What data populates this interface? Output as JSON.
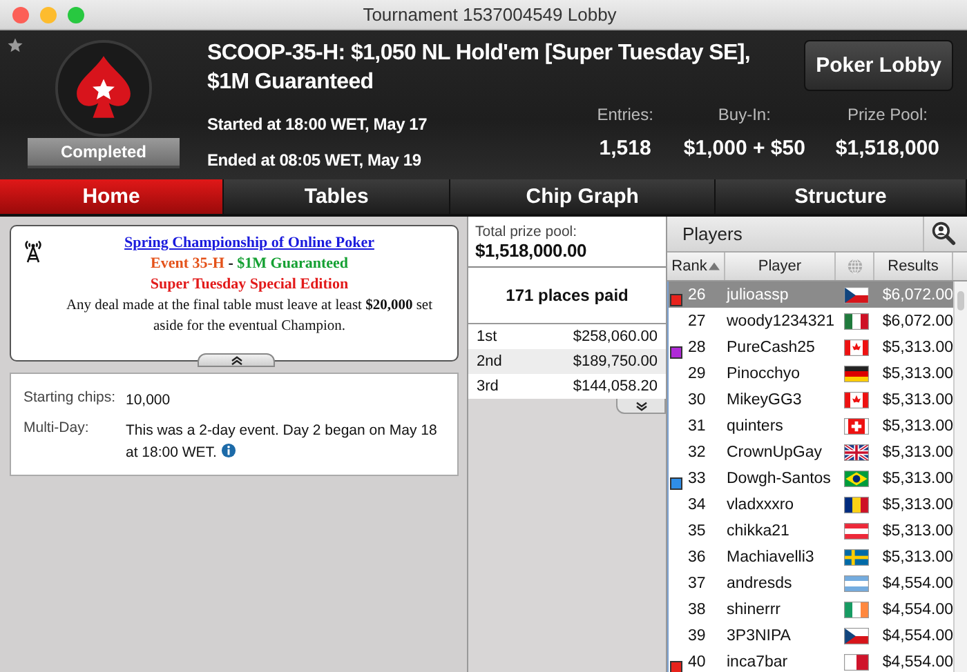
{
  "window": {
    "title": "Tournament 1537004549 Lobby"
  },
  "header": {
    "status": "Completed",
    "title": "SCOOP-35-H: $1,050 NL Hold'em [Super Tuesday SE], $1M Guaranteed",
    "started": "Started at 18:00 WET, May 17",
    "ended": "Ended at 08:05 WET, May 19",
    "stats": [
      {
        "label": "Entries:",
        "value": "1,518"
      },
      {
        "label": "Buy-In:",
        "value": "$1,000 + $50"
      },
      {
        "label": "Prize Pool:",
        "value": "$1,518,000"
      }
    ],
    "button": "Poker Lobby"
  },
  "tabs": [
    {
      "label": "Home",
      "selected": true
    },
    {
      "label": "Tables",
      "selected": false
    },
    {
      "label": "Chip Graph",
      "selected": false
    },
    {
      "label": "Structure",
      "selected": false
    }
  ],
  "announcement": {
    "link": "Spring Championship of Online Poker",
    "event": "Event 35-H",
    "separator": "-",
    "guarantee": "$1M Guaranteed",
    "edition": "Super Tuesday Special Edition",
    "notice": "Any deal made at the final table must leave at least **$20,000** set aside for the eventual Champion."
  },
  "details": [
    {
      "label": "Starting chips:",
      "value": "10,000",
      "info": false
    },
    {
      "label": "Multi-Day:",
      "value": "This was a 2-day event. Day 2 began on May 18 at 18:00 WET.",
      "info": true
    }
  ],
  "prizes": {
    "total_label": "Total prize pool:",
    "total": "$1,518,000.00",
    "places": "171 places paid",
    "rows": [
      {
        "place": "1st",
        "amount": "$258,060.00"
      },
      {
        "place": "2nd",
        "amount": "$189,750.00"
      },
      {
        "place": "3rd",
        "amount": "$144,058.20"
      }
    ]
  },
  "players": {
    "title": "Players",
    "columns": [
      "Rank",
      "Player",
      "Results"
    ],
    "rows": [
      {
        "rank": "26",
        "name": "julioassp",
        "kind": "czech",
        "result": "$6,072.00",
        "selected": true,
        "color": "#e8231c"
      },
      {
        "rank": "27",
        "name": "woody1234321",
        "kind": "mexico",
        "result": "$6,072.00",
        "selected": false
      },
      {
        "rank": "28",
        "name": "PureCash25",
        "kind": "canada",
        "result": "$5,313.00",
        "selected": false,
        "color": "#b02ad8"
      },
      {
        "rank": "29",
        "name": "Pinocchyo",
        "kind": "germany",
        "result": "$5,313.00",
        "selected": false
      },
      {
        "rank": "30",
        "name": "MikeyGG3",
        "kind": "canada",
        "result": "$5,313.00",
        "selected": false
      },
      {
        "rank": "31",
        "name": "quinters",
        "kind": "swiss",
        "result": "$5,313.00",
        "selected": false
      },
      {
        "rank": "32",
        "name": "CrownUpGay",
        "kind": "uk",
        "result": "$5,313.00",
        "selected": false
      },
      {
        "rank": "33",
        "name": "Dowgh-Santos",
        "kind": "brazil",
        "result": "$5,313.00",
        "selected": false,
        "color": "#2f8ee8"
      },
      {
        "rank": "34",
        "name": "vladxxxro",
        "kind": "romania",
        "result": "$5,313.00",
        "selected": false
      },
      {
        "rank": "35",
        "name": "chikka21",
        "kind": "austria",
        "result": "$5,313.00",
        "selected": false
      },
      {
        "rank": "36",
        "name": "Machiavelli3",
        "kind": "sweden",
        "result": "$5,313.00",
        "selected": false
      },
      {
        "rank": "37",
        "name": "andresds",
        "kind": "argentina",
        "result": "$4,554.00",
        "selected": false
      },
      {
        "rank": "38",
        "name": "shinerrr",
        "kind": "ireland",
        "result": "$4,554.00",
        "selected": false
      },
      {
        "rank": "39",
        "name": "3P3NIPA",
        "kind": "czech",
        "result": "$4,554.00",
        "selected": false
      },
      {
        "rank": "40",
        "name": "inca7bar",
        "kind": "malta",
        "result": "$4,554.00",
        "selected": false,
        "color": "#e8231c"
      }
    ]
  }
}
